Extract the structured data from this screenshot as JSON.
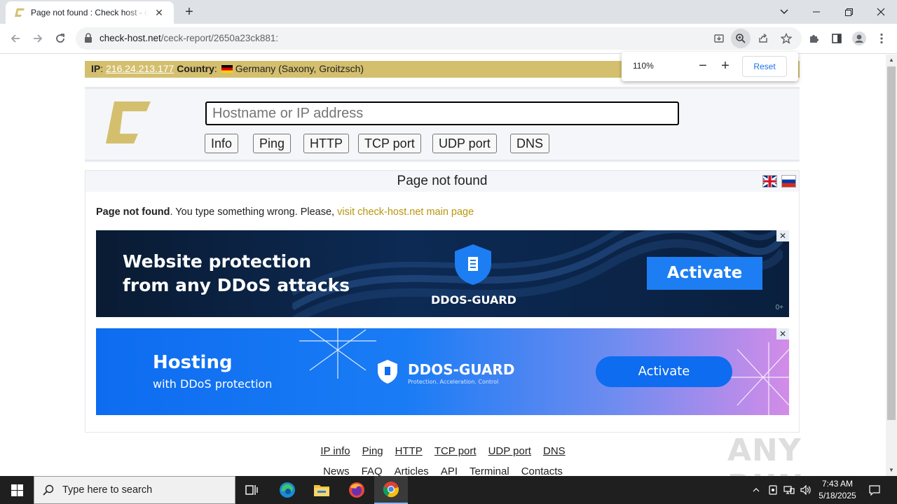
{
  "browser": {
    "tab_title": "Page not found : Check host - online website monitoring",
    "tab_close": "✕",
    "new_tab": "+",
    "url_domain": "check-host.net",
    "url_path": "/ceck-report/2650a23ck881:",
    "zoom": {
      "level": "110%",
      "minus": "−",
      "plus": "+",
      "reset_label": "Reset"
    }
  },
  "site": {
    "ip_label": "IP",
    "ip_value": "216.24.213.177",
    "country_label": "Country",
    "country_value": "Germany (Saxony, Groitzsch)",
    "host_placeholder": "Hostname or IP address",
    "check_buttons": [
      "Info",
      "Ping",
      "HTTP",
      "TCP port",
      "UDP port",
      "DNS"
    ],
    "panel_title": "Page not found",
    "message_bold": "Page not found",
    "message_text": ". You type something wrong. Please, ",
    "message_link": "visit check-host.net main page",
    "ad1": {
      "line1": "Website protection",
      "line2": "from any DDoS attacks",
      "brand": "DDOS-GUARD",
      "cta": "Activate",
      "age": "0+",
      "close": "✕"
    },
    "ad2": {
      "line1": "Hosting",
      "line2": "with DDoS protection",
      "brand": "DDOS-GUARD",
      "tagline": "Protection. Acceleration. Control",
      "cta": "Activate",
      "close": "✕"
    },
    "footer_row1": [
      "IP info",
      "Ping",
      "HTTP",
      "TCP port",
      "UDP port",
      "DNS"
    ],
    "footer_row2": [
      "News",
      "FAQ",
      "Articles",
      "API",
      "Terminal",
      "Contacts"
    ],
    "accent_color": "#d4bf6e"
  },
  "watermark": "ANY RUN",
  "taskbar": {
    "search_placeholder": "Type here to search",
    "time": "7:43 AM",
    "date": "5/18/2025"
  }
}
